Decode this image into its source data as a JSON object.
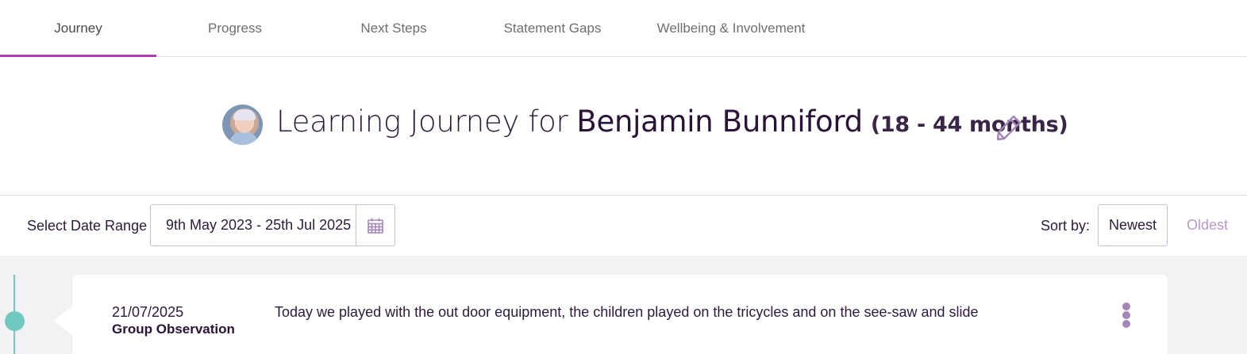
{
  "tabs": [
    {
      "label": "Journey",
      "active": true
    },
    {
      "label": "Progress",
      "active": false
    },
    {
      "label": "Next Steps",
      "active": false
    },
    {
      "label": "Statement Gaps",
      "active": false
    },
    {
      "label": "Wellbeing & Involvement",
      "active": false
    }
  ],
  "header": {
    "title_prefix": "Learning Journey for",
    "child_name": "Benjamin Bunniford",
    "age_range": "(18 - 44 months)",
    "edit_icon": "pencil-icon"
  },
  "filters": {
    "date_range_label": "Select Date Range",
    "date_range_value": "9th May 2023 - 25th Jul 2025",
    "calendar_icon": "calendar-icon",
    "sort_label": "Sort by:",
    "sort_newest": "Newest",
    "sort_oldest": "Oldest",
    "sort_selected": "Newest"
  },
  "observations": [
    {
      "date": "21/07/2025",
      "type": "Group Observation",
      "text": "Today we played with the out door equipment, the children played on the tricycles and on the see-saw and slide"
    }
  ],
  "colors": {
    "accent": "#b03ab5",
    "timeline": "#6fc9c1",
    "text_dark": "#2d1a3d",
    "muted_purple": "#b79ac6",
    "background": "#f3f1f4"
  }
}
